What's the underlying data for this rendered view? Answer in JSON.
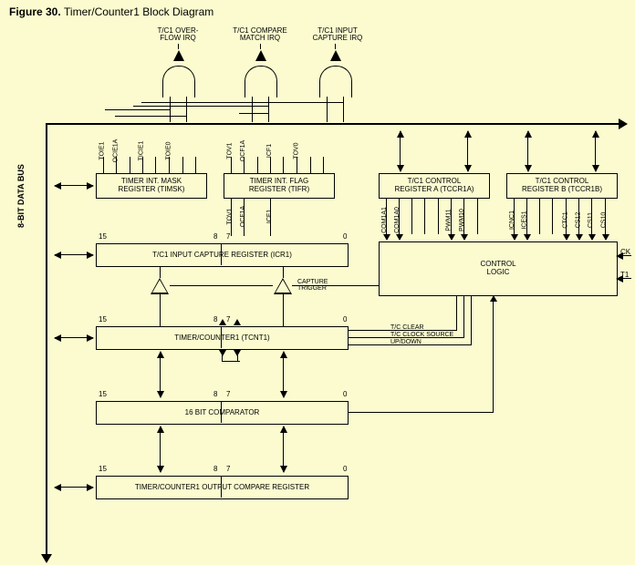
{
  "figure": {
    "no": "Figure 30.",
    "title": "Timer/Counter1 Block Diagram"
  },
  "bus_label": "8-BIT DATA BUS",
  "irq": {
    "ovf": "T/C1 OVER-\nFLOW IRQ",
    "cmp": "T/C1 COMPARE\nMATCH IRQ",
    "cap": "T/C1 INPUT\nCAPTURE IRQ"
  },
  "regs": {
    "timsk": "TIMER INT. MASK\nREGISTER (TIMSK)",
    "tifr": "TIMER INT. FLAG\nREGISTER (TIFR)",
    "tccra": "T/C1 CONTROL\nREGISTER A (TCCR1A)",
    "tccrb": "T/C1 CONTROL\nREGISTER B (TCCR1B)",
    "icr1": "T/C1 INPUT CAPTURE REGISTER (ICR1)",
    "tcnt1": "TIMER/COUNTER1 (TCNT1)",
    "comp": "16 BIT COMPARATOR",
    "ocr": "TIMER/COUNTER1 OUTPUT COMPARE REGISTER",
    "ctrl": "CONTROL\nLOGIC"
  },
  "pins_timsk": [
    "TOIE1",
    "OCIE1A",
    "-",
    "TICIE1",
    "-",
    "TOIE0",
    "-",
    "-"
  ],
  "pins_tifr": [
    "TOV1",
    "OCF1A",
    "-",
    "ICF1",
    "-",
    "TOV0",
    "-",
    "-"
  ],
  "pins_tifr2": [
    "TOV1",
    "OCF1A",
    "-",
    "ICF1",
    "-",
    "-",
    "-",
    "-"
  ],
  "pins_tccra": [
    "COM1A1",
    "COM1A0",
    "-",
    "-",
    "-",
    "-",
    "PWM11",
    "PWM10"
  ],
  "pins_tccrb": [
    "ICNC1",
    "ICES1",
    "-",
    "-",
    "CTC1",
    "CS12",
    "CS11",
    "CS10"
  ],
  "cap_trig": "CAPTURE\nTRIGGER",
  "ctrl_sig": {
    "clear": "T/C CLEAR",
    "clk": "T/C CLOCK SOURCE",
    "ud": "UP/DOWN"
  },
  "ext": {
    "ck": "CK",
    "t1": "T1"
  },
  "regbits": {
    "hi": "15",
    "midhi": "8",
    "midlo": "7",
    "lo": "0"
  }
}
